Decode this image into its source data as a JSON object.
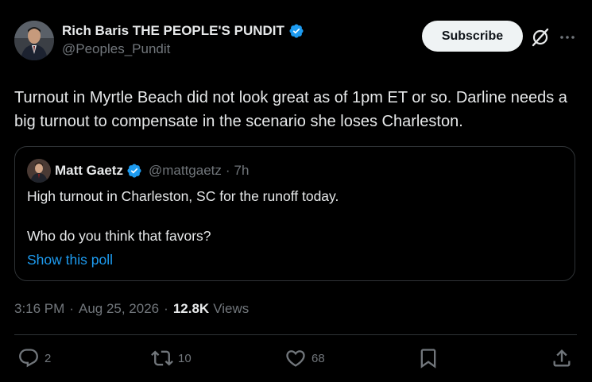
{
  "tweet": {
    "author": {
      "name": "Rich Baris THE PEOPLE'S PUNDIT",
      "handle": "@Peoples_Pundit",
      "verified": true,
      "avatar_icon": "avatar-photo-man-suit"
    },
    "subscribe_label": "Subscribe",
    "text": "Turnout in Myrtle Beach did not look great as of 1pm ET or so. Darline needs a big turnout to compensate in the scenario she loses Charleston.",
    "quote": {
      "author_name": "Matt Gaetz",
      "author_handle": "@mattgaetz",
      "verified": true,
      "separator": "·",
      "time": "7h",
      "line1": "High turnout in Charleston, SC for the runoff today.",
      "line2": "Who do you think that favors?",
      "show_poll_label": "Show this poll"
    },
    "meta": {
      "time": "3:16 PM",
      "separator": "·",
      "date": "Aug 25, 2026",
      "views_count": "12.8K",
      "views_label": "Views"
    },
    "actions": {
      "replies": "2",
      "reposts": "10",
      "likes": "68"
    }
  },
  "colors": {
    "background": "#000000",
    "text_primary": "#e7e9ea",
    "text_secondary": "#71767b",
    "accent_blue": "#1d9bf0",
    "border": "#2f3336",
    "subscribe_bg": "#eff3f4"
  },
  "icons": [
    "verified-badge-icon",
    "grok-icon",
    "more-options-icon",
    "reply-icon",
    "repost-icon",
    "like-icon",
    "bookmark-icon",
    "share-icon"
  ]
}
